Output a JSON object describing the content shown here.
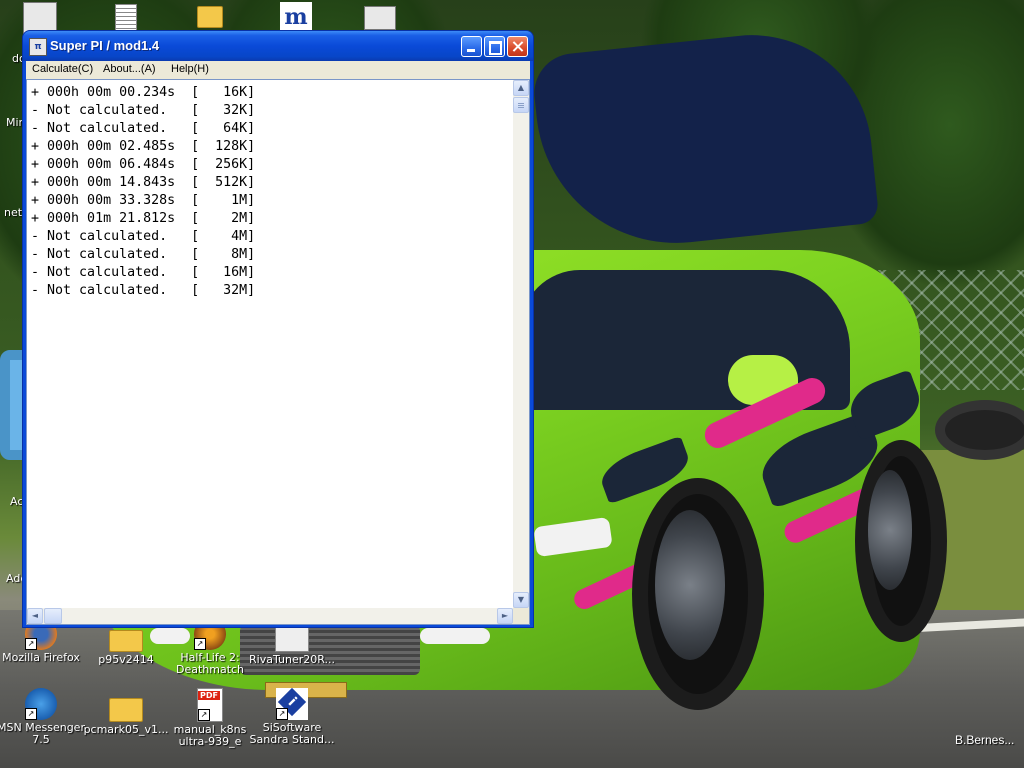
{
  "window": {
    "title": "Super PI / mod1.4",
    "app_icon_text": "SUPER"
  },
  "menu": {
    "calculate": "Calculate(C)",
    "about": "About...(A)",
    "help": "Help(H)"
  },
  "results": [
    {
      "status": "+",
      "time": "000h 00m 00.234s",
      "digits": "16K"
    },
    {
      "status": "-",
      "time": "Not calculated.",
      "digits": "32K"
    },
    {
      "status": "-",
      "time": "Not calculated.",
      "digits": "64K"
    },
    {
      "status": "+",
      "time": "000h 00m 02.485s",
      "digits": "128K"
    },
    {
      "status": "+",
      "time": "000h 00m 06.484s",
      "digits": "256K"
    },
    {
      "status": "+",
      "time": "000h 00m 14.843s",
      "digits": "512K"
    },
    {
      "status": "+",
      "time": "000h 00m 33.328s",
      "digits": "1M"
    },
    {
      "status": "+",
      "time": "000h 01m 21.812s",
      "digits": "2M"
    },
    {
      "status": "-",
      "time": "Not calculated.",
      "digits": "4M"
    },
    {
      "status": "-",
      "time": "Not calculated.",
      "digits": "8M"
    },
    {
      "status": "-",
      "time": "Not calculated.",
      "digits": "16M"
    },
    {
      "status": "-",
      "time": "Not calculated.",
      "digits": "32M"
    }
  ],
  "scrollbars": {
    "up": "▲",
    "down": "▼",
    "left": "◄",
    "right": "►"
  },
  "desktop_icons": [
    {
      "name": "firefox",
      "label": "Mozilla Firefox",
      "icon": "firefox-icon"
    },
    {
      "name": "p95",
      "label": "p95v2414",
      "icon": "folder-icon"
    },
    {
      "name": "halflife",
      "label": "Half-Life 2: Deathmatch",
      "label_line1": "Half-Life 2:",
      "label_line2": "Deathmatch",
      "icon": "half-life-icon"
    },
    {
      "name": "rivatuner",
      "label": "RivaTuner20R...",
      "icon": "rivatuner-icon"
    },
    {
      "name": "msn",
      "label_line1": "MSN Messenger",
      "label_line2": "7.5",
      "icon": "msn-icon"
    },
    {
      "name": "pcmark",
      "label": "pcmark05_v1...",
      "icon": "folder-icon"
    },
    {
      "name": "manual",
      "label_line1": "manual_k8ns",
      "label_line2": "ultra-939_e",
      "icon": "pdf-icon"
    },
    {
      "name": "sandra",
      "label_line1": "SiSoftware",
      "label_line2": "Sandra Stand...",
      "icon": "sandra-icon"
    }
  ],
  "edge_labels": {
    "do": "do",
    "min": "Min",
    "nett": "nett",
    "ac": "Ac",
    "ade": "Ade"
  },
  "watermark": "B.Bernes...",
  "colors": {
    "titlebar": "#0a4ad8",
    "close_button": "#d84a2a",
    "menubar": "#ece9d8"
  }
}
